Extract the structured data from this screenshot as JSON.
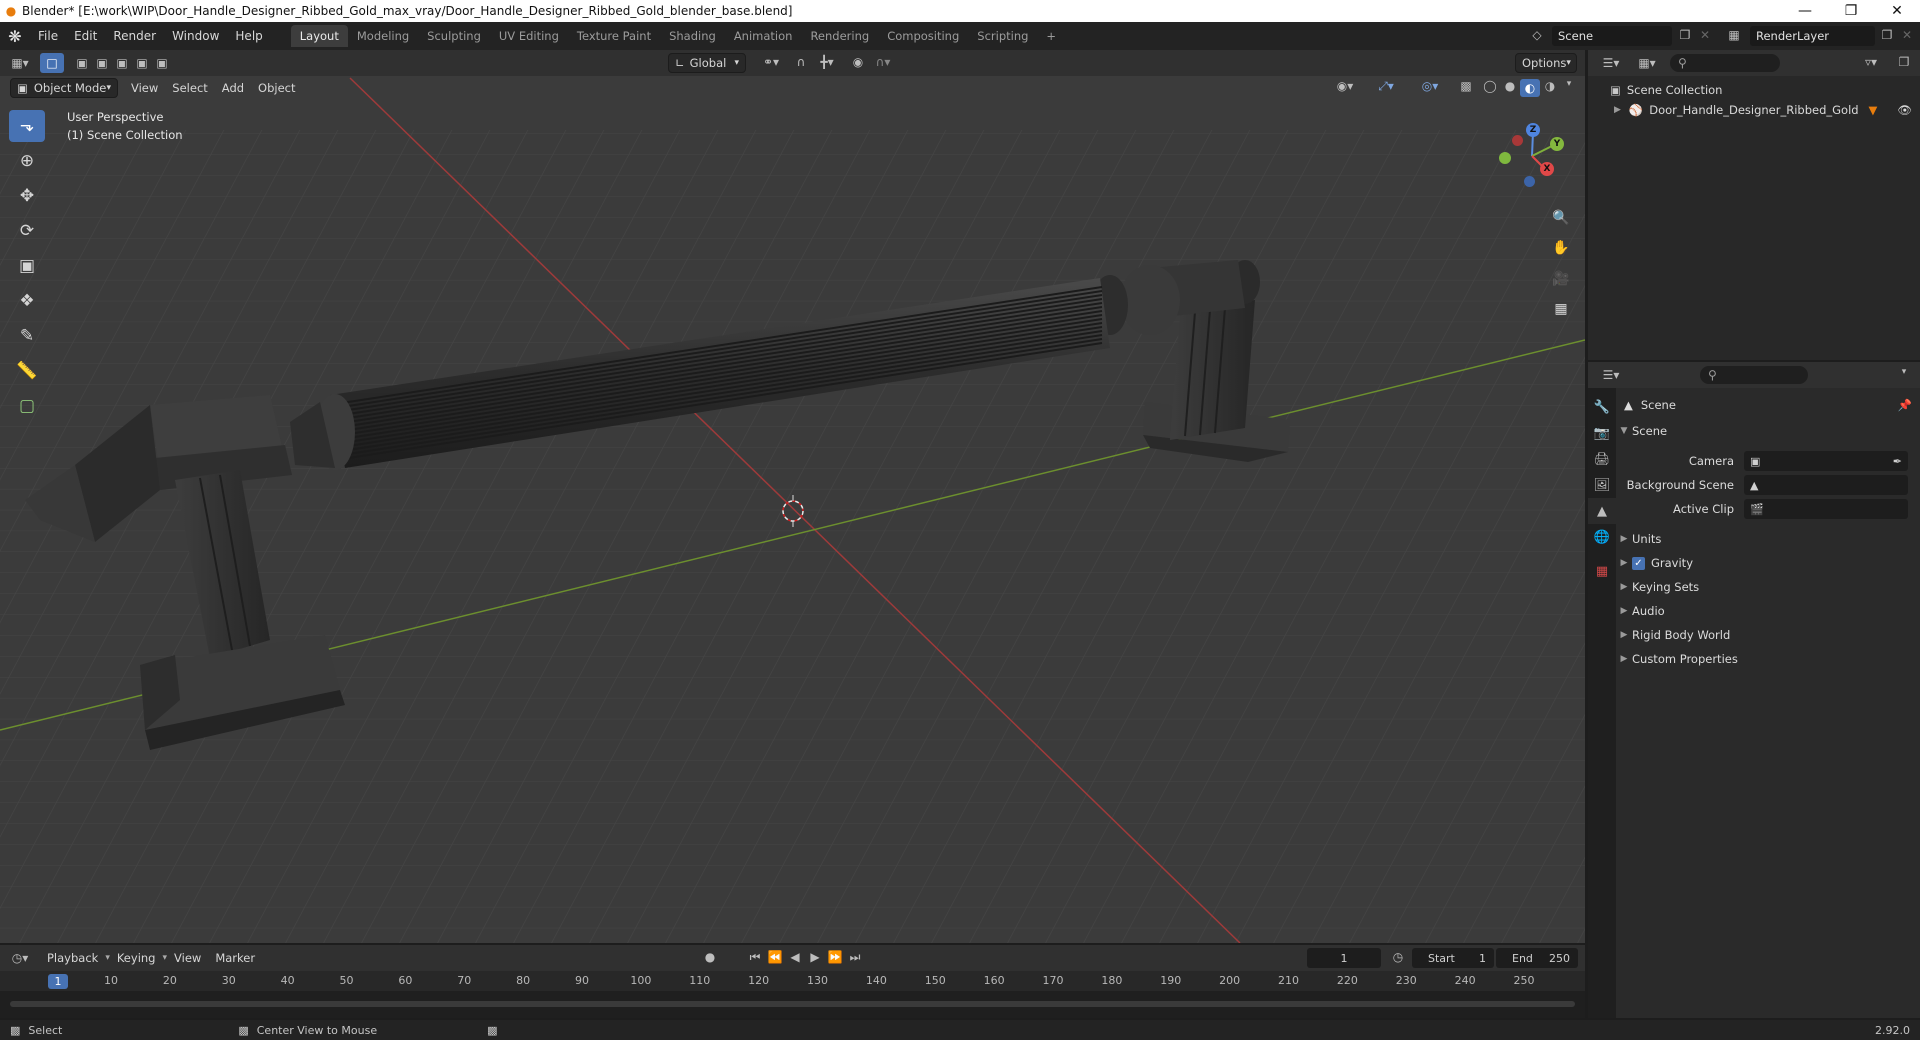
{
  "window": {
    "title": "Blender* [E:\\work\\WIP\\Door_Handle_Designer_Ribbed_Gold_max_vray/Door_Handle_Designer_Ribbed_Gold_blender_base.blend]",
    "minimize": "—",
    "maximize": "❐",
    "close": "✕"
  },
  "menu": [
    "File",
    "Edit",
    "Render",
    "Window",
    "Help"
  ],
  "workspaces": [
    {
      "label": "Layout",
      "active": true
    },
    {
      "label": "Modeling",
      "active": false
    },
    {
      "label": "Sculpting",
      "active": false
    },
    {
      "label": "UV Editing",
      "active": false
    },
    {
      "label": "Texture Paint",
      "active": false
    },
    {
      "label": "Shading",
      "active": false
    },
    {
      "label": "Animation",
      "active": false
    },
    {
      "label": "Rendering",
      "active": false
    },
    {
      "label": "Compositing",
      "active": false
    },
    {
      "label": "Scripting",
      "active": false
    }
  ],
  "scene_selector": {
    "value": "Scene"
  },
  "render_layer": {
    "value": "RenderLayer"
  },
  "viewport": {
    "header": {
      "orientation": "Global",
      "options": "Options"
    },
    "mode": "Object Mode",
    "menus": [
      "View",
      "Select",
      "Add",
      "Object"
    ],
    "info_line1": "User Perspective",
    "info_line2": "(1) Scene Collection",
    "gizmo": {
      "z": "Z",
      "y": "Y",
      "x": "X"
    }
  },
  "outliner": {
    "root": "Scene Collection",
    "items": [
      {
        "label": "Door_Handle_Designer_Ribbed_Gold"
      }
    ]
  },
  "properties": {
    "context": "Scene",
    "panel": "Scene",
    "fields": [
      {
        "label": "Camera",
        "value": ""
      },
      {
        "label": "Background Scene",
        "value": ""
      },
      {
        "label": "Active Clip",
        "value": ""
      }
    ],
    "sections": [
      {
        "label": "Units",
        "checkbox": false
      },
      {
        "label": "Gravity",
        "checkbox": true
      },
      {
        "label": "Keying Sets",
        "checkbox": false
      },
      {
        "label": "Audio",
        "checkbox": false
      },
      {
        "label": "Rigid Body World",
        "checkbox": false
      },
      {
        "label": "Custom Properties",
        "checkbox": false
      }
    ]
  },
  "timeline": {
    "menus": [
      "Playback",
      "Keying",
      "View",
      "Marker"
    ],
    "current_frame": "1",
    "start_label": "Start",
    "start_value": "1",
    "end_label": "End",
    "end_value": "250",
    "ruler": [
      "1",
      "10",
      "20",
      "30",
      "40",
      "50",
      "60",
      "70",
      "80",
      "90",
      "100",
      "110",
      "120",
      "130",
      "140",
      "150",
      "160",
      "170",
      "180",
      "190",
      "200",
      "210",
      "220",
      "230",
      "240",
      "250"
    ]
  },
  "status": {
    "left": "Select",
    "middle": "Center View to Mouse",
    "version": "2.92.0"
  },
  "colors": {
    "accent": "#4772b3",
    "x_axis": "#9e3a3a",
    "y_axis": "#6c8f2e",
    "object_orange": "#e87d0d"
  }
}
